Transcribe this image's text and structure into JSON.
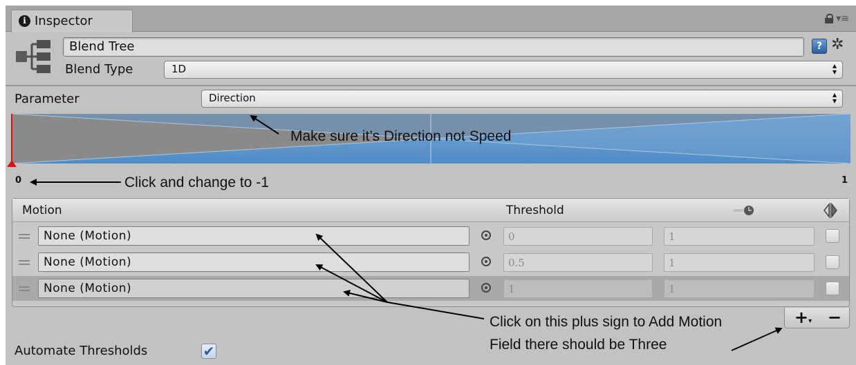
{
  "tab": {
    "title": "Inspector",
    "info_icon": "info-icon"
  },
  "header": {
    "name": "Blend Tree",
    "blend_type_label": "Blend Type",
    "blend_type_value": "1D",
    "help_icon": "?"
  },
  "parameter": {
    "label": "Parameter",
    "value": "Direction"
  },
  "graph": {
    "min_label": "0",
    "max_label": "1"
  },
  "motion_list": {
    "header_motion": "Motion",
    "header_threshold": "Threshold",
    "rows": [
      {
        "motion": "None (Motion)",
        "threshold": "0",
        "speed": "1",
        "mirror": false
      },
      {
        "motion": "None (Motion)",
        "threshold": "0.5",
        "speed": "1",
        "mirror": false
      },
      {
        "motion": "None (Motion)",
        "threshold": "1",
        "speed": "1",
        "mirror": false
      }
    ]
  },
  "footer": {
    "plus": "+",
    "plus_suffix": "▾",
    "minus": "−"
  },
  "automate": {
    "label": "Automate Thresholds",
    "checked": true,
    "check_glyph": "✔"
  },
  "annotations": {
    "direction": "Make sure it’s Direction not Speed",
    "change_min": "Click and change to -1",
    "plus_line1": "Click on this plus sign to Add Motion",
    "plus_line2": "Field there should be Three"
  },
  "colors": {
    "graph_blue": "#5f9bd3",
    "graph_grey": "#7e7e7e",
    "marker_red": "#d11111"
  }
}
